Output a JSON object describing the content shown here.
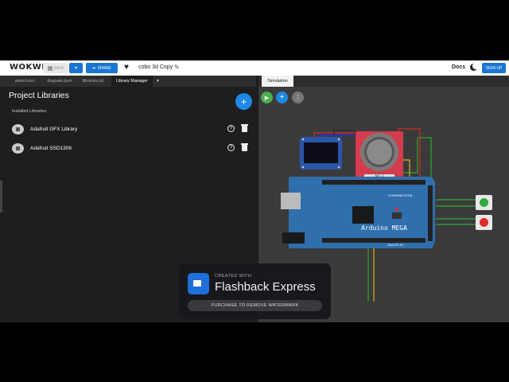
{
  "topbar": {
    "logo": "WOKWI",
    "save_label": "SAVE",
    "share_label": "SHARE",
    "project_name": "cobo 3d Copy",
    "docs_label": "Docs",
    "signup_label": "SIGN UP"
  },
  "tabs": [
    {
      "label": "sketch.ino"
    },
    {
      "label": "diagram.json"
    },
    {
      "label": "libraries.txt"
    },
    {
      "label": "Library Manager"
    }
  ],
  "sim_tab": "Simulation",
  "library_manager": {
    "title": "Project Libraries",
    "section": "Installed Libraries",
    "libraries": [
      {
        "name": "Adafruit GFX Library"
      },
      {
        "name": "Adafruit SSD1306"
      }
    ]
  },
  "board": {
    "label": "Arduino MEGA",
    "header_text": "COMMUNICATION",
    "bottom_text": "ANALOG IN",
    "sensor_label": "MQ-2"
  },
  "watermark": {
    "small": "CREATED WITH",
    "brand": "Flashback Express",
    "purchase": "PURCHASE TO REMOVE WATERMARK"
  },
  "colors": {
    "accent": "#1976d2",
    "play": "#4caf50",
    "board": "#2f6fab",
    "sensor": "#d43b4c",
    "btn_green": "#2eaa3e",
    "btn_red": "#e02a2a"
  }
}
